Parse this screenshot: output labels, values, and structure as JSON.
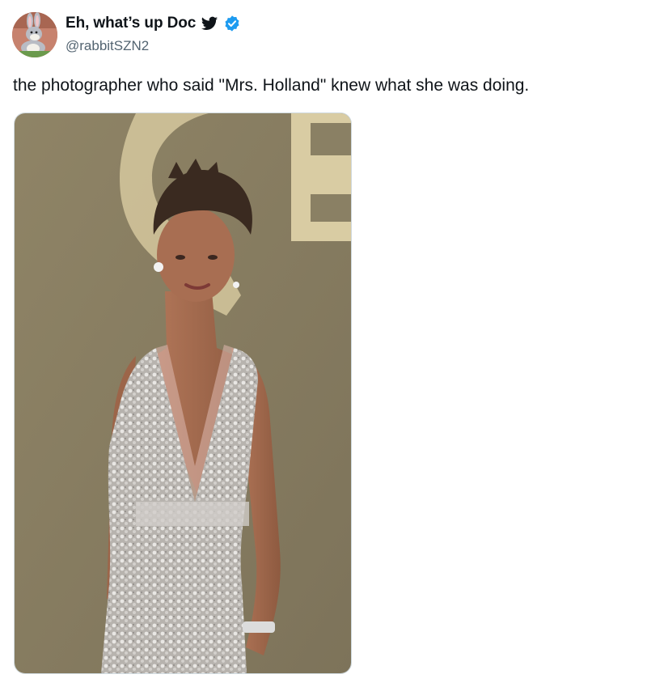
{
  "tweet": {
    "display_name": "Eh, what’s up Doc",
    "handle": "@rabbitSZN2",
    "text": "the photographer who said \"Mrs. Holland\" knew what she was doing.",
    "icons": {
      "bird": "bird-icon",
      "verified": "verified-badge-icon",
      "avatar": "avatar-image"
    },
    "colors": {
      "verified_badge": "#1d9bf0",
      "handle": "#536471",
      "text": "#0f1419"
    }
  }
}
